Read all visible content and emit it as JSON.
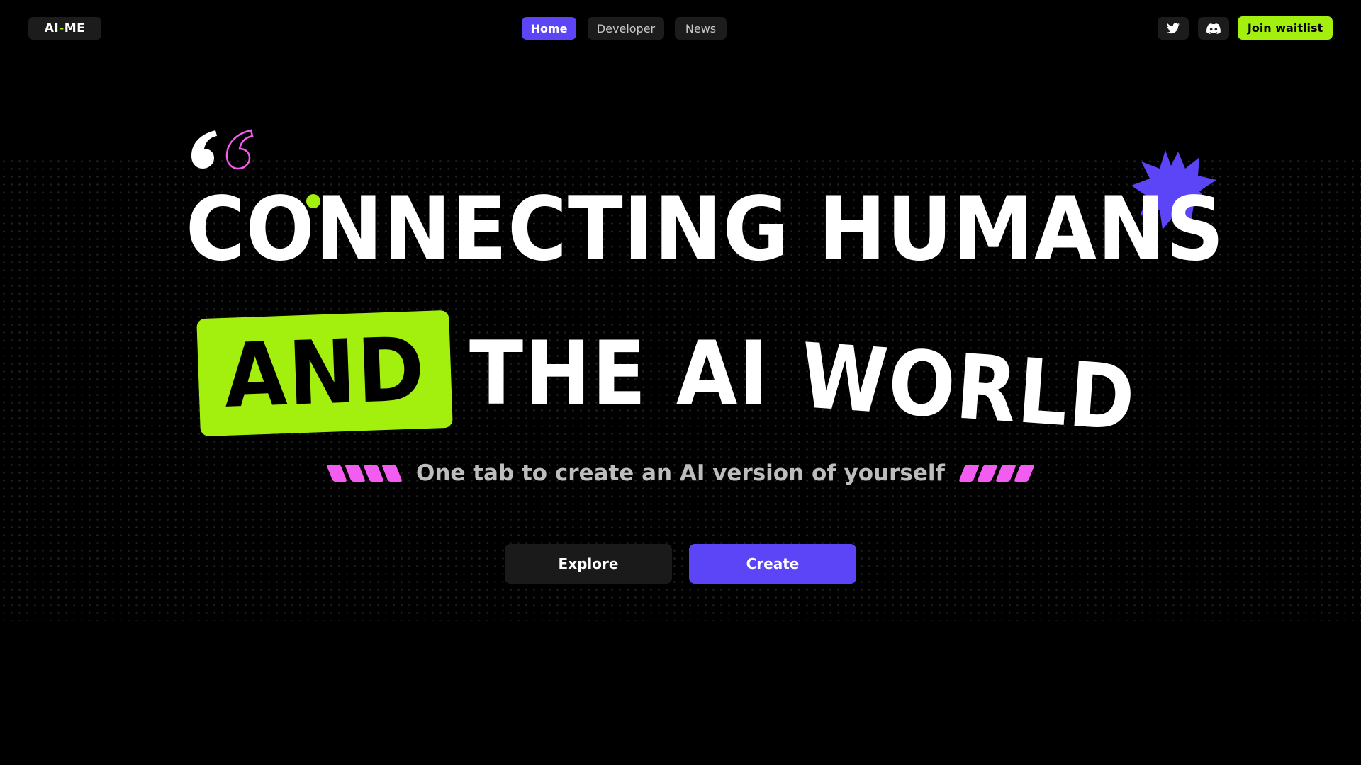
{
  "brand": {
    "logo_prefix": "AI",
    "logo_dash": "-",
    "logo_suffix": "ME",
    "accent": "#a3f00f",
    "primary": "#5b45f6",
    "pink": "#f35cf0"
  },
  "nav": {
    "links": [
      {
        "label": "Home",
        "active": true
      },
      {
        "label": "Developer",
        "active": false
      },
      {
        "label": "News",
        "active": false
      }
    ],
    "social": [
      "twitter-icon",
      "discord-icon"
    ],
    "waitlist_label": "Join waitlist"
  },
  "hero": {
    "line1": "CONNECTING HUMANS",
    "and": "AND",
    "the_ai": "THE AI",
    "world": "WORLD",
    "tagline": "One tab to create an AI version of yourself",
    "buttons": {
      "explore": "Explore",
      "create": "Create"
    }
  }
}
